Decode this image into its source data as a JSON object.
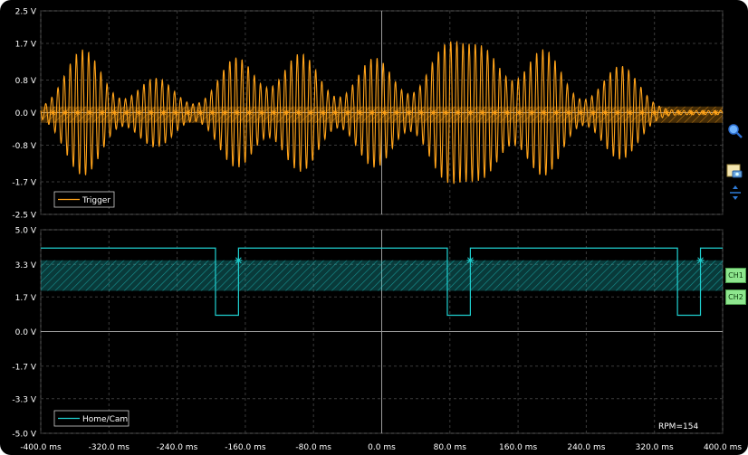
{
  "chart_data": [
    {
      "type": "line",
      "series": [
        {
          "name": "Trigger",
          "color": "#ffa31a"
        }
      ],
      "ylim": [
        -2.5,
        2.5
      ],
      "y_ticks": [
        "2.5 V",
        "1.7 V",
        "0.8 V",
        "0.0 V",
        "-0.8 V",
        "-1.7 V",
        "-2.5 V"
      ],
      "y_tick_values": [
        2.5,
        1.7,
        0.8,
        0.0,
        -0.8,
        -1.7,
        -2.5
      ],
      "xlim": [
        -400,
        400
      ],
      "grid": true,
      "legend": "bottom-left",
      "burst_centers_ms": [
        -350,
        -265,
        -170,
        -95,
        -8,
        75,
        120,
        190,
        280
      ],
      "burst_peaks_v": [
        1.5,
        0.8,
        1.3,
        1.4,
        1.3,
        1.5,
        1.4,
        1.5,
        1.1
      ],
      "threshold_band_v": [
        -0.25,
        0.15
      ]
    },
    {
      "type": "line",
      "series": [
        {
          "name": "Home/Cam",
          "color": "#1fd0d0"
        }
      ],
      "ylim": [
        -5.0,
        5.0
      ],
      "y_ticks": [
        "5.0 V",
        "3.3 V",
        "1.7 V",
        "0.0 V",
        "-1.7 V",
        "-3.3 V",
        "-5.0 V"
      ],
      "y_tick_values": [
        5.0,
        3.3,
        1.7,
        0.0,
        -1.7,
        -3.3,
        -5.0
      ],
      "xlim": [
        -400,
        400
      ],
      "high_v": 4.1,
      "low_v": 0.8,
      "low_intervals_ms": [
        [
          -195,
          -168
        ],
        [
          77,
          104
        ],
        [
          347,
          374
        ]
      ],
      "trigger_points_ms": [
        -168,
        104,
        374
      ],
      "trigger_level_v": 3.5,
      "threshold_band_v": [
        2.0,
        3.5
      ],
      "grid": true,
      "legend": "bottom-left",
      "annotation": "RPM=154"
    }
  ],
  "x_ticks": [
    "-400.0 ms",
    "-320.0 ms",
    "-240.0 ms",
    "-160.0 ms",
    "-80.0 ms",
    "0.0 ms",
    "80.0 ms",
    "160.0 ms",
    "240.0 ms",
    "320.0 ms",
    "400.0 ms"
  ],
  "x_tick_values": [
    -400,
    -320,
    -240,
    -160,
    -80,
    0,
    80,
    160,
    240,
    320,
    400
  ],
  "channels": [
    "CH1",
    "CH2"
  ],
  "icons": [
    "zoom-icon",
    "camera-icon",
    "scale-icon"
  ],
  "colors": {
    "background": "#000000",
    "grid": "#3a3a3a",
    "trigger": "#ffa31a",
    "cam": "#1fd0d0",
    "channel_button": "#8ee68e"
  }
}
